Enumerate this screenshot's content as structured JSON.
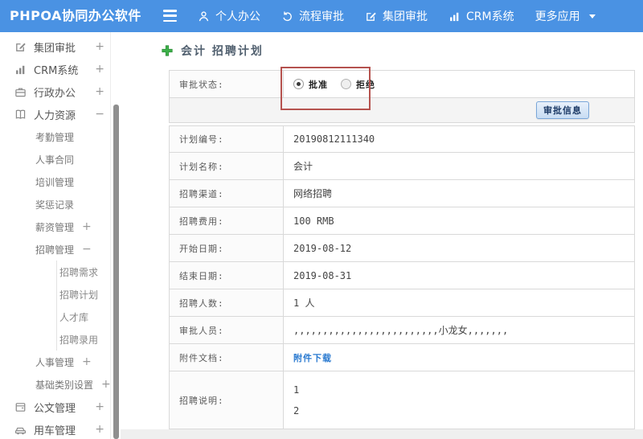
{
  "topbar": {
    "logo": "PHPOA协同办公软件",
    "nav": [
      {
        "label": "个人办公",
        "icon": "user-icon"
      },
      {
        "label": "流程审批",
        "icon": "process-icon"
      },
      {
        "label": "集团审批",
        "icon": "edit-square-icon"
      },
      {
        "label": "CRM系统",
        "icon": "bar-chart-icon"
      },
      {
        "label": "更多应用",
        "icon": "caret-down-icon"
      }
    ]
  },
  "sidebar": {
    "items": [
      {
        "label": "集团审批",
        "level": 1,
        "icon": "edit-square-icon",
        "expander": "+"
      },
      {
        "label": "CRM系统",
        "level": 1,
        "icon": "bar-chart-icon",
        "expander": "+"
      },
      {
        "label": "行政办公",
        "level": 1,
        "icon": "briefcase-icon",
        "expander": "+"
      },
      {
        "label": "人力资源",
        "level": 1,
        "icon": "book-icon",
        "expander": "−"
      },
      {
        "label": "考勤管理",
        "level": 2
      },
      {
        "label": "人事合同",
        "level": 2
      },
      {
        "label": "培训管理",
        "level": 2
      },
      {
        "label": "奖惩记录",
        "level": 2
      },
      {
        "label": "薪资管理",
        "level": 2,
        "expander": "+"
      },
      {
        "label": "招聘管理",
        "level": 2,
        "expander": "−"
      },
      {
        "label": "招聘需求",
        "level": 3
      },
      {
        "label": "招聘计划",
        "level": 3
      },
      {
        "label": "人才库",
        "level": 3
      },
      {
        "label": "招聘录用",
        "level": 3
      },
      {
        "label": "人事管理",
        "level": 2,
        "expander": "+"
      },
      {
        "label": "基础类别设置",
        "level": 2,
        "expander": "+"
      },
      {
        "label": "公文管理",
        "level": 1,
        "icon": "document-icon",
        "expander": "+"
      },
      {
        "label": "用车管理",
        "level": 1,
        "icon": "car-icon",
        "expander": "+"
      }
    ]
  },
  "main": {
    "title": "会计 招聘计划",
    "title_icon": "add-icon",
    "approval": {
      "status_label": "审批状态:",
      "options": [
        {
          "label": "批准",
          "checked": true
        },
        {
          "label": "拒绝",
          "checked": false
        }
      ],
      "info_button": "审批信息"
    },
    "fields": [
      {
        "label": "计划编号:",
        "value": "20190812111340"
      },
      {
        "label": "计划名称:",
        "value": "会计"
      },
      {
        "label": "招聘渠道:",
        "value": "网络招聘"
      },
      {
        "label": "招聘费用:",
        "value": "100 RMB"
      },
      {
        "label": "开始日期:",
        "value": "2019-08-12"
      },
      {
        "label": "结束日期:",
        "value": "2019-08-31"
      },
      {
        "label": "招聘人数:",
        "value": "1 人"
      },
      {
        "label": "审批人员:",
        "value": ",,,,,,,,,,,,,,,,,,,,,,,,,小龙女,,,,,,,"
      },
      {
        "label": "附件文档:",
        "value": "附件下载",
        "type": "link"
      },
      {
        "label": "招聘说明:",
        "type": "multiline",
        "lines": [
          "1",
          "2"
        ]
      }
    ]
  },
  "colors": {
    "topbar": "#4a92e3",
    "highlight_box": "#b5524e",
    "link": "#2a7ad0",
    "add_icon_green": "#3db14a",
    "button_border": "#79a6d8",
    "button_text": "#1c3a66"
  }
}
